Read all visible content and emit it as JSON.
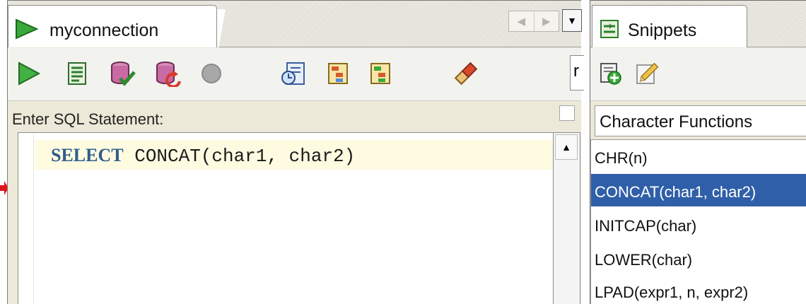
{
  "worksheet": {
    "tab_label": "myconnection",
    "overflow_tab_label": "r",
    "sql_label": "Enter SQL Statement:",
    "code_keyword": "SELECT",
    "code_rest": " CONCAT(char1, char2)"
  },
  "snippets": {
    "tab_label": "Snippets",
    "category": "Character Functions",
    "items": [
      "CHR(n)",
      "CONCAT(char1, char2)",
      "INITCAP(char)",
      "LOWER(char)",
      "LPAD(expr1, n, expr2)"
    ],
    "selected_index": 1
  },
  "colors": {
    "selection": "#2f5fa8",
    "keyword": "#2d5d8e",
    "current_line": "#fefbe1",
    "arrow": "#e0141e"
  }
}
